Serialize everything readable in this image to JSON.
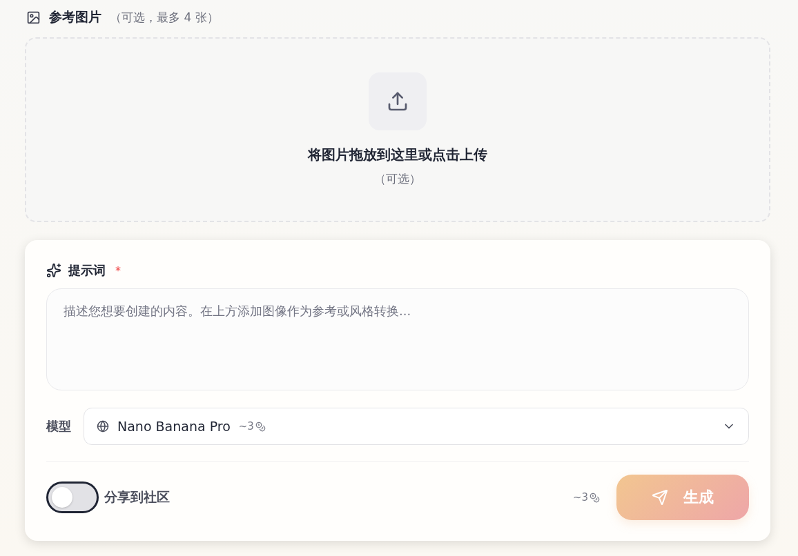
{
  "reference": {
    "title": "参考图片",
    "hint": "（可选，最多 4 张）",
    "dropzone": {
      "title": "将图片拖放到这里或点击上传",
      "subtitle": "（可选）"
    }
  },
  "prompt": {
    "label": "提示词",
    "required_mark": "*",
    "placeholder": "描述您想要创建的内容。在上方添加图像作为参考或风格转换..."
  },
  "model": {
    "label": "模型",
    "value": "Nano Banana Pro",
    "cost": "~3"
  },
  "share": {
    "label": "分享到社区",
    "on": false
  },
  "cost": "~3",
  "generate": {
    "label": "生成",
    "disabled": true
  }
}
